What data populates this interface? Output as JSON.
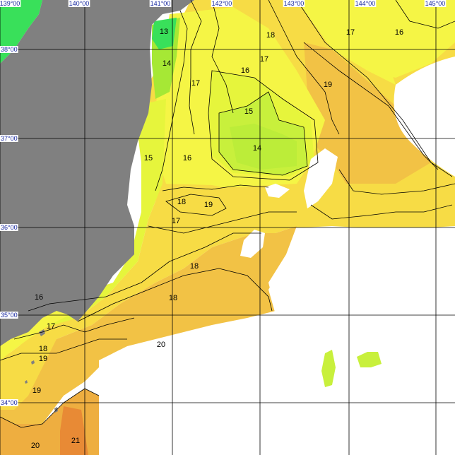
{
  "map": {
    "lon_labels": [
      "139°00",
      "140°00",
      "141°00",
      "142°00",
      "143°00",
      "144°00",
      "145°00"
    ],
    "lat_labels": [
      "38°00",
      "37°00",
      "36°00",
      "35°00",
      "34°00"
    ],
    "isotherm_labels": [
      {
        "id": "t13",
        "text": "13"
      },
      {
        "id": "t14a",
        "text": "14"
      },
      {
        "id": "t17a",
        "text": "17"
      },
      {
        "id": "t16a",
        "text": "16"
      },
      {
        "id": "t17b",
        "text": "17"
      },
      {
        "id": "t18a",
        "text": "18"
      },
      {
        "id": "t17c",
        "text": "17"
      },
      {
        "id": "t16b",
        "text": "16"
      },
      {
        "id": "t19a",
        "text": "19"
      },
      {
        "id": "t15a",
        "text": "15"
      },
      {
        "id": "t14b",
        "text": "14"
      },
      {
        "id": "t15b",
        "text": "15"
      },
      {
        "id": "t16c",
        "text": "16"
      },
      {
        "id": "t18b",
        "text": "18"
      },
      {
        "id": "t19b",
        "text": "19"
      },
      {
        "id": "t17d",
        "text": "17"
      },
      {
        "id": "t18c",
        "text": "18"
      },
      {
        "id": "t18d",
        "text": "18"
      },
      {
        "id": "t19c",
        "text": "19"
      },
      {
        "id": "t16d",
        "text": "16"
      },
      {
        "id": "t17e",
        "text": "17"
      },
      {
        "id": "t18e",
        "text": "18"
      },
      {
        "id": "t20a",
        "text": "20"
      },
      {
        "id": "t19d",
        "text": "19"
      },
      {
        "id": "t20b",
        "text": "20"
      },
      {
        "id": "t21",
        "text": "21"
      }
    ],
    "colors": {
      "land": "#808080",
      "no_data": "#ffffff",
      "sst_13": "#39e05a",
      "sst_14": "#a6e835",
      "sst_15": "#c8f03c",
      "sst_16": "#e6f53c",
      "sst_17": "#f5f545",
      "sst_18": "#f7dc45",
      "sst_19": "#f2c245",
      "sst_20": "#eeae40",
      "sst_21": "#e88a35",
      "grid": "#000000",
      "tick_text": "#1a2aa0"
    }
  }
}
